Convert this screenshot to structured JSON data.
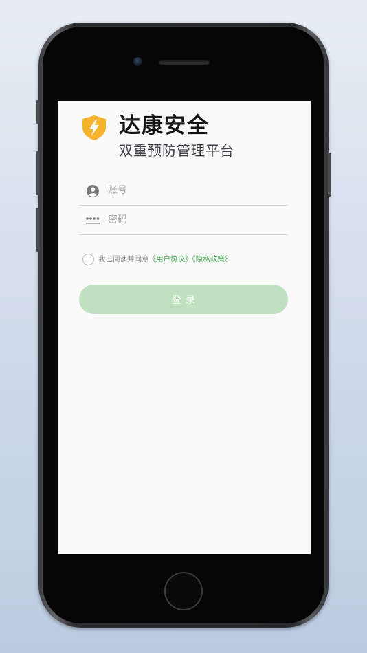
{
  "app": {
    "name": "达康安全",
    "subtitle": "双重预防管理平台",
    "logo_icon": "shield-lightning-icon",
    "brand_color": "#f5b32e"
  },
  "login_form": {
    "account": {
      "placeholder": "账号",
      "value": "",
      "icon": "user-avatar-icon"
    },
    "password": {
      "placeholder": "密码",
      "value": "",
      "icon": "password-dots-icon"
    },
    "agreement": {
      "checked": false,
      "prefix": "我已阅读并同意",
      "user_agreement": "《用户协议》",
      "privacy_policy": "《隐私政策》"
    },
    "login_button": {
      "label": "登录",
      "color": "#bfe1c0"
    }
  },
  "colors": {
    "accent_link": "#45a64f",
    "screen_background": "#fafafa"
  }
}
